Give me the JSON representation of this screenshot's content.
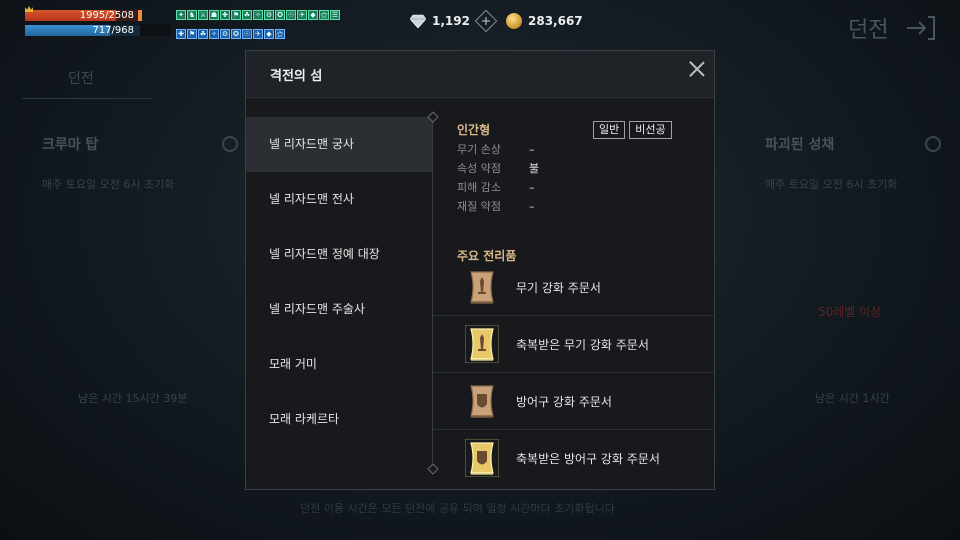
{
  "hud": {
    "hp_text": "1995/2508",
    "hp_fraction": 0.795,
    "mp_text": "717/968",
    "mp_fraction": 0.741,
    "buffs_row1": 15,
    "buffs_row2": 10,
    "diamond_count": "1,192",
    "gold_count": "283,667"
  },
  "background": {
    "title": "던전",
    "tab": "던전",
    "col1_title": "크루마 탑",
    "col1_desc": "매주 토요일 오전 6시 초기화",
    "col2_title": "파괴된 성채",
    "col2_desc": "매주 토요일 오전 6시 초기화",
    "col1_time": "남은 시간 15시간 39분",
    "col2_time": "남은 시간 1시간",
    "warn": "50레벨 이상",
    "footer": "던전 이용 시간은 모든 던전에 공유 되며 일정 시간마다 초기화됩니다"
  },
  "modal": {
    "title": "격전의 섬",
    "monsters": [
      "넬 리자드맨 궁사",
      "넬 리자드맨 전사",
      "넬 리자드맨 정예 대장",
      "넬 리자드맨 주술사",
      "모래 거미",
      "모래 라케르타"
    ],
    "selected_index": 0,
    "info": {
      "type": "인간형",
      "tags": [
        "일반",
        "비선공"
      ],
      "rows": [
        {
          "k": "무기 손상",
          "v": "–"
        },
        {
          "k": "속성 약점",
          "v": "불"
        },
        {
          "k": "피해 감소",
          "v": "–"
        },
        {
          "k": "재질 약점",
          "v": "–"
        }
      ]
    },
    "loot_title": "주요 전리품",
    "loot": [
      {
        "name": "무기 강화 주문서",
        "icon": "weapon-scroll-icon",
        "blessed": false
      },
      {
        "name": "축복받은 무기 강화 주문서",
        "icon": "blessed-weapon-scroll-icon",
        "blessed": true
      },
      {
        "name": "방어구 강화 주문서",
        "icon": "armor-scroll-icon",
        "blessed": false
      },
      {
        "name": "축복받은 방어구 강화 주문서",
        "icon": "blessed-armor-scroll-icon",
        "blessed": true
      }
    ]
  },
  "colors": {
    "accent_label": "#d9b98a",
    "hp": "#c9421f",
    "mp": "#2e7fc2"
  }
}
